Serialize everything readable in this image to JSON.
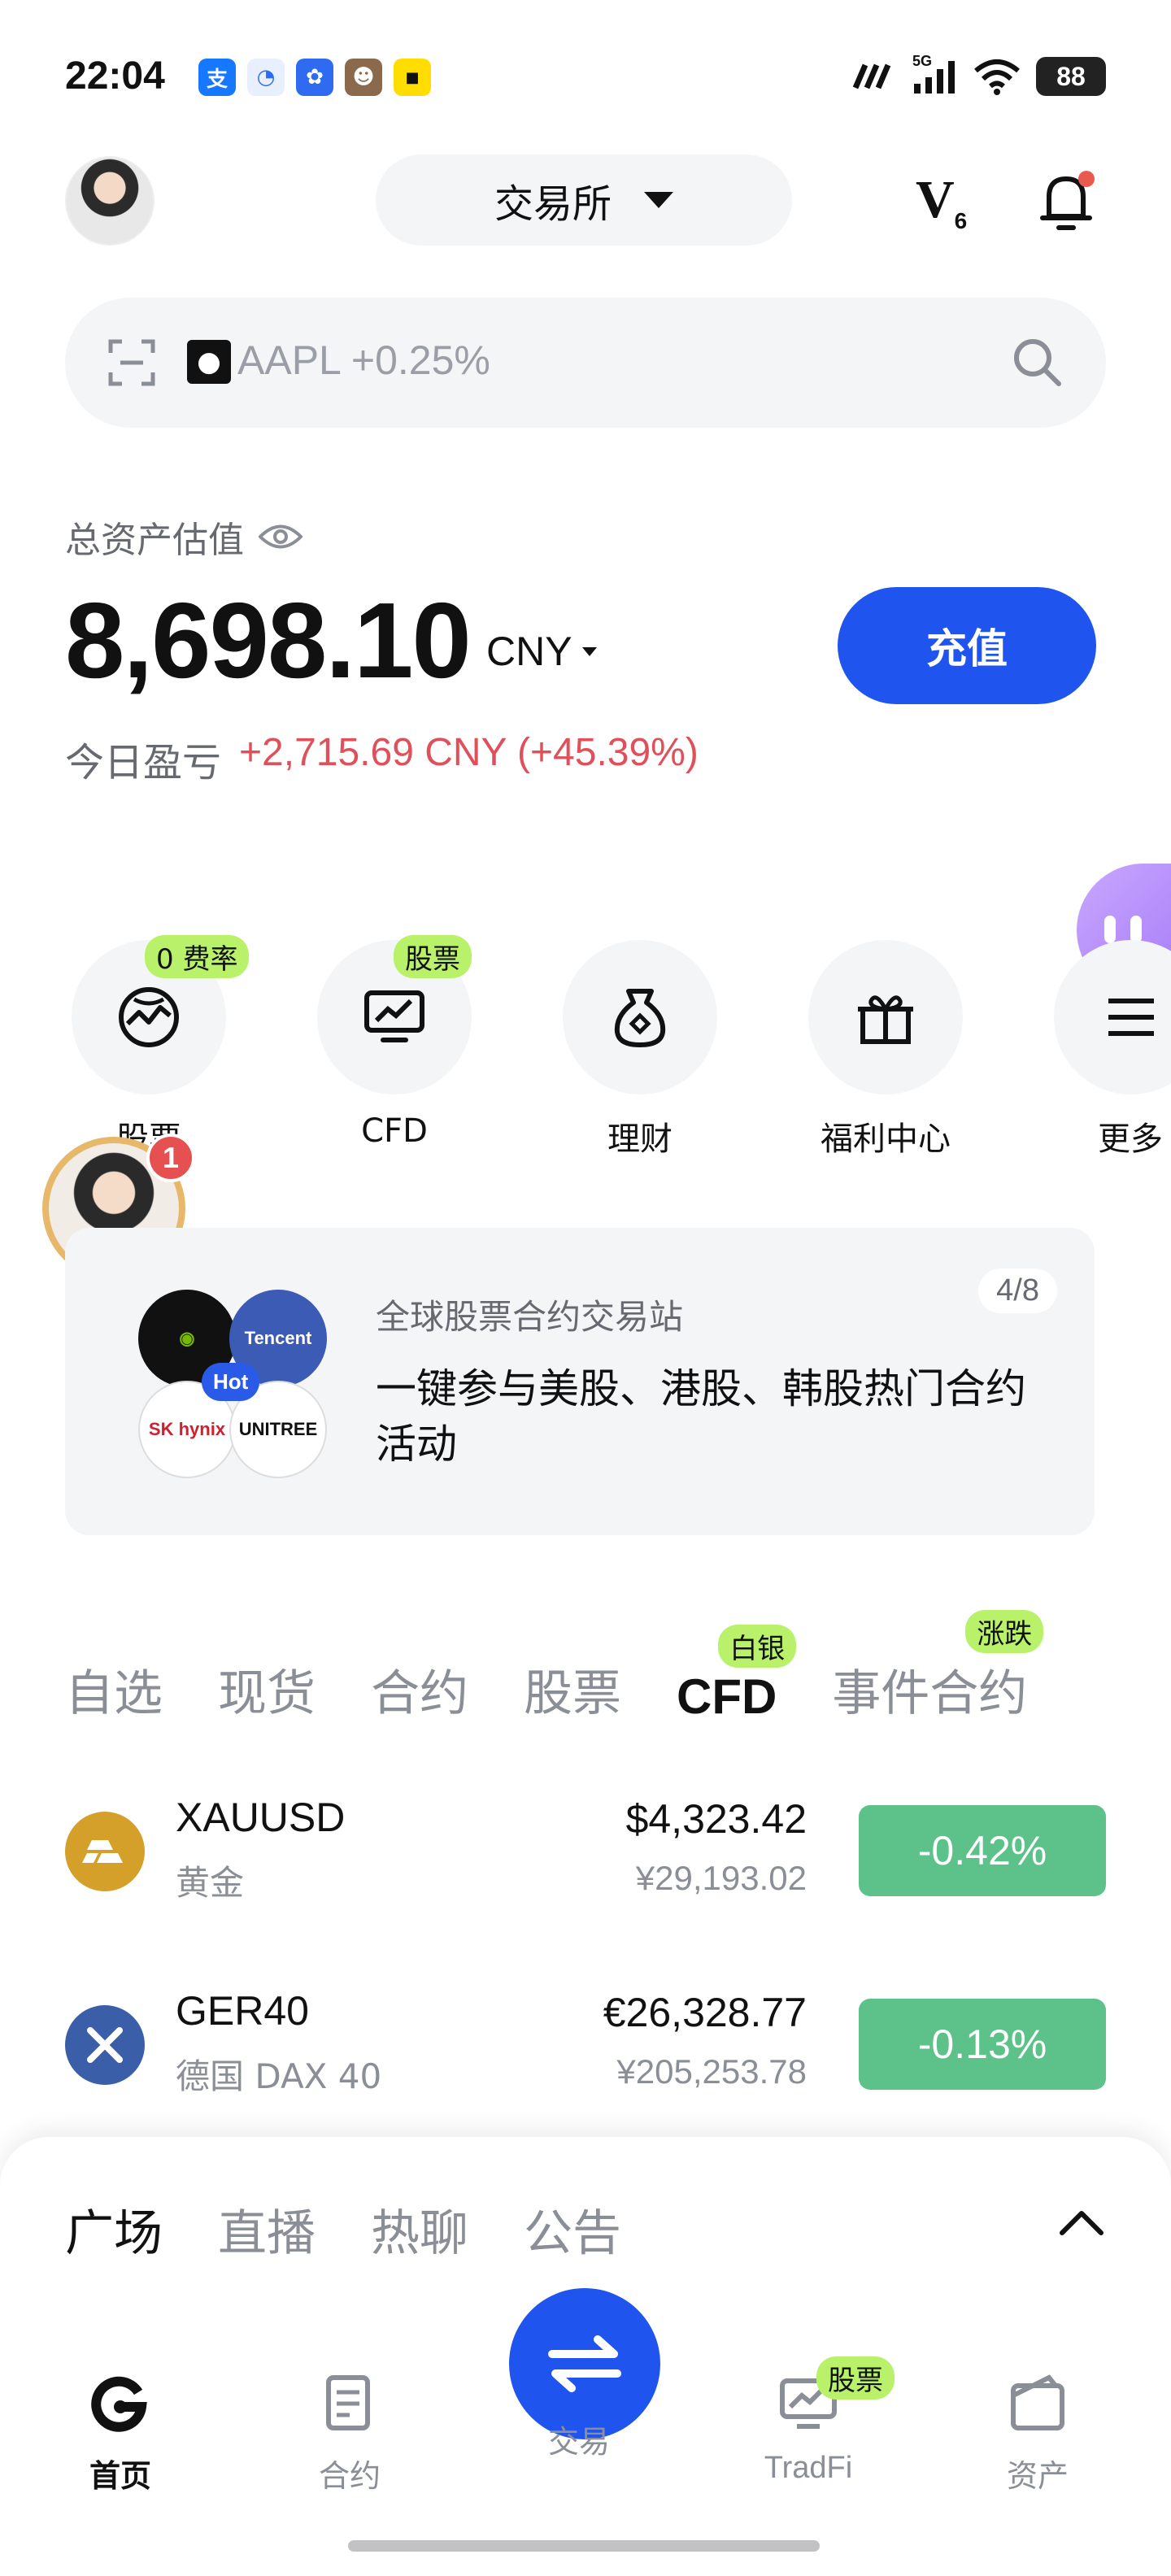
{
  "status_bar": {
    "time": "22:04",
    "network": "5G",
    "battery": "88",
    "app_icons": [
      "alipay-icon",
      "baidu-icon",
      "app-icon",
      "game-icon",
      "yellow-app-icon"
    ]
  },
  "header": {
    "exchange_label": "交易所",
    "vip_level": "V",
    "vip_sub": "6"
  },
  "search": {
    "ticker_text": "AAPL +0.25%"
  },
  "assets": {
    "label": "总资产估值",
    "value": "8,698.10",
    "currency": "CNY",
    "deposit_label": "充值",
    "pnl_label": "今日盈亏",
    "pnl_value": "+2,715.69 CNY (+45.39%)"
  },
  "shortcuts": [
    {
      "label": "股票",
      "tag": "0 费率"
    },
    {
      "label": "CFD",
      "tag": "股票"
    },
    {
      "label": "理财",
      "tag": ""
    },
    {
      "label": "福利中心",
      "tag": ""
    },
    {
      "label": "更多",
      "tag": ""
    }
  ],
  "live": {
    "badge": "1"
  },
  "promo": {
    "title": "全球股票合约交易站",
    "body": "一键参与美股、港股、韩股热门合约活动",
    "counter": "4/8",
    "hot": "Hot",
    "logos": [
      "NVIDIA",
      "Tencent",
      "SK hynix",
      "UNITREE"
    ]
  },
  "market_tabs": [
    {
      "label": "自选",
      "tag": ""
    },
    {
      "label": "现货",
      "tag": ""
    },
    {
      "label": "合约",
      "tag": ""
    },
    {
      "label": "股票",
      "tag": ""
    },
    {
      "label": "CFD",
      "tag": "白银"
    },
    {
      "label": "事件合约",
      "tag": "涨跌"
    }
  ],
  "market_rows": [
    {
      "symbol": "XAUUSD",
      "name": "黄金",
      "price": "$4,323.42",
      "price_cny": "¥29,193.02",
      "change": "-0.42%"
    },
    {
      "symbol": "GER40",
      "name": "德国 DAX 40",
      "price": "€26,328.77",
      "price_cny": "¥205,253.78",
      "change": "-0.13%"
    }
  ],
  "sheet": {
    "tabs": [
      "广场",
      "直播",
      "热聊",
      "公告"
    ]
  },
  "nav": {
    "home": "首页",
    "contract": "合约",
    "trade": "交易",
    "tradfi": "TradFi",
    "tradfi_tag": "股票",
    "assets": "资产"
  },
  "colors": {
    "brand_blue": "#1f55ee",
    "pnl_red": "#e0505a",
    "change_green": "#5cc28a",
    "tag_lime": "#b9f26a"
  }
}
